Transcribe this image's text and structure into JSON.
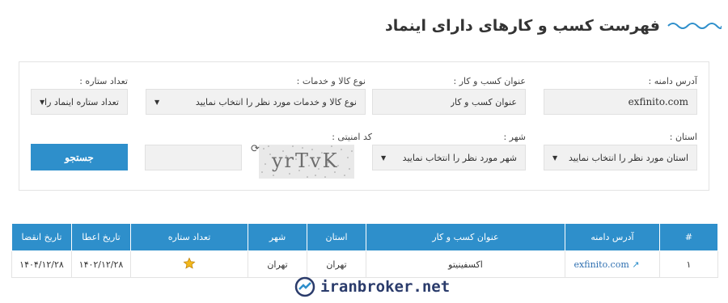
{
  "header": {
    "title": "فهرست کسب و کارهای دارای اینماد"
  },
  "filters": {
    "domain": {
      "label": "آدرس دامنه :",
      "value": "exfinito.com"
    },
    "business_title": {
      "label": "عنوان کسب و کار :",
      "value": "عنوان کسب و کار"
    },
    "goods_services": {
      "label": "نوع کالا و خدمات :",
      "value": "نوع کالا و خدمات مورد نظر را انتخاب نمایید"
    },
    "stars": {
      "label": "تعداد ستاره :",
      "value": "تعداد ستاره اینماد را"
    },
    "province": {
      "label": "استان :",
      "value": "استان مورد نظر را انتخاب نمایید"
    },
    "city": {
      "label": "شهر :",
      "value": "شهر مورد نظر را انتخاب نمایید"
    },
    "security_code": {
      "label": "کد امنیتی :",
      "value": "",
      "captcha_text": "yrTvK"
    },
    "search_label": "جستجو"
  },
  "table": {
    "headers": [
      "#",
      "آدرس دامنه",
      "عنوان کسب و کار",
      "استان",
      "شهر",
      "تعداد ستاره",
      "تاریخ اعطا",
      "تاریخ انقضا"
    ],
    "rows": [
      {
        "index": "۱",
        "domain": "exfinito.com",
        "business": "اکسفینیتو",
        "province": "تهران",
        "city": "تهران",
        "stars": 1,
        "issue_date": "۱۴۰۲/۱۲/۲۸",
        "expiry_date": "۱۴۰۴/۱۲/۲۸"
      }
    ]
  },
  "watermark": {
    "text": "iranbroker.net"
  },
  "colors": {
    "accent": "#2e8fcb",
    "header_text": "#333333",
    "field_bg": "#f1f1f1"
  }
}
